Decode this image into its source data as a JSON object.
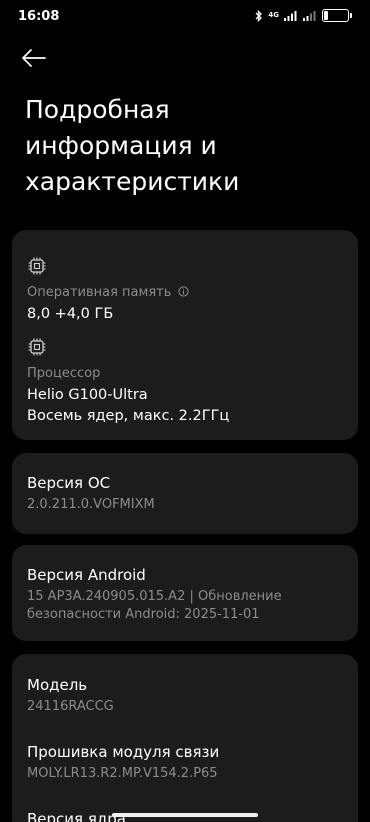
{
  "status_bar": {
    "time": "16:08",
    "network_label": "4G",
    "battery_level": "22",
    "battery_fraction": 0.22,
    "icons": [
      "bluetooth-icon",
      "signal-icon",
      "signal-icon",
      "battery-icon"
    ]
  },
  "header": {
    "back_icon": "arrow-left-icon",
    "title": "Подробная информация и характеристики"
  },
  "hardware": {
    "ram": {
      "icon": "chip-icon",
      "label": "Оперативная память",
      "label_icon": "info-icon",
      "value": "8,0 +4,0 ГБ"
    },
    "cpu": {
      "icon": "chip-icon",
      "label": "Процессор",
      "value_line1": "Helio G100-Ultra",
      "value_line2": "Восемь ядер, макс. 2.2ГГц"
    }
  },
  "os_version": {
    "title": "Версия ОС",
    "value": "2.0.211.0.VOFMIXM"
  },
  "android_version": {
    "title": "Версия Android",
    "value": "15 AP3A.240905.015.A2 | Обновление безопасности Android: 2025-11-01"
  },
  "model_card": {
    "model_title": "Модель",
    "model_value": "24116RACCG",
    "baseband_title": "Прошивка модуля связи",
    "baseband_value": "MOLY.LR13.R2.MP.V154.2.P65",
    "kernel_title": "Версия ядра"
  },
  "colors": {
    "background": "#000000",
    "card": "#1c1c1c",
    "primary_text": "#ffffff",
    "secondary_text": "#8c8c8c"
  }
}
